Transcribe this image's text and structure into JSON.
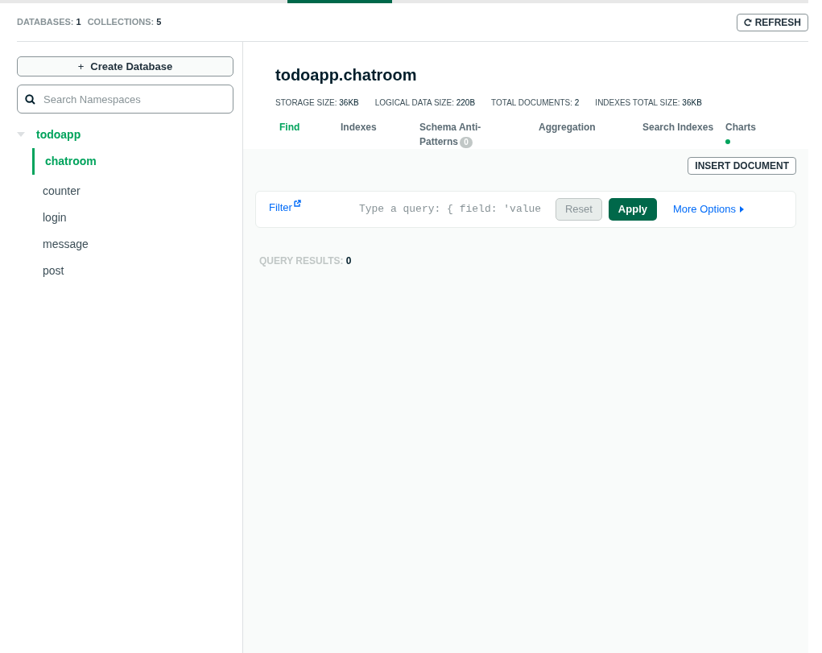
{
  "summary": [
    {
      "label": "DATABASES:",
      "value": "1"
    },
    {
      "label": "COLLECTIONS:",
      "value": "5"
    }
  ],
  "refresh_button": {
    "label": "REFRESH"
  },
  "sidebar": {
    "create_button": {
      "icon": "+",
      "label": "Create Database"
    },
    "search": {
      "placeholder": "Search Namespaces"
    },
    "databases": [
      {
        "name": "todoapp",
        "expanded": true,
        "children": [
          {
            "name": "chatroom",
            "selected": true
          },
          {
            "name": "counter",
            "selected": false
          },
          {
            "name": "login",
            "selected": false
          },
          {
            "name": "message",
            "selected": false
          },
          {
            "name": "post",
            "selected": false
          }
        ]
      }
    ]
  },
  "collection": {
    "title": "todoapp.chatroom",
    "stats": [
      {
        "label": "STORAGE SIZE:",
        "value": "36KB"
      },
      {
        "label": "LOGICAL DATA SIZE:",
        "value": "220B"
      },
      {
        "label": "TOTAL DOCUMENTS:",
        "value": "2"
      },
      {
        "label": "INDEXES TOTAL SIZE:",
        "value": "36KB"
      }
    ],
    "tabs": [
      {
        "label": "Find",
        "selected": true
      },
      {
        "label": "Indexes",
        "selected": false
      },
      {
        "label": "Schema Anti-Patterns",
        "selected": false,
        "badge": "0"
      },
      {
        "label": "Aggregation",
        "selected": false
      },
      {
        "label": "Search Indexes",
        "selected": false
      },
      {
        "label": "Charts",
        "selected": false,
        "status_dot": true
      }
    ]
  },
  "insert_button": {
    "label": "INSERT DOCUMENT"
  },
  "query_bar": {
    "filter_link": "Filter",
    "placeholder": "Type a query: { field: 'value",
    "reset": {
      "label": "Reset",
      "disabled": true
    },
    "apply": {
      "label": "Apply",
      "disabled": false
    },
    "more_options": "More Options"
  },
  "results": {
    "label": "QUERY RESULTS:",
    "value": "0"
  }
}
